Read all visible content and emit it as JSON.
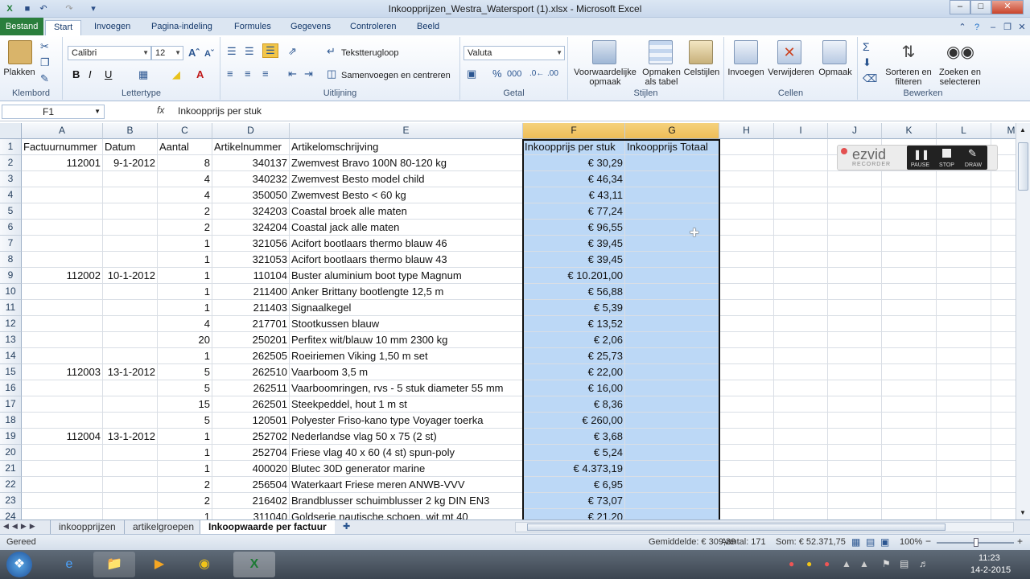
{
  "window": {
    "title": "Inkoopprijzen_Westra_Watersport (1).xlsx - Microsoft Excel"
  },
  "ribbon_tabs": [
    "Bestand",
    "Start",
    "Invoegen",
    "Pagina-indeling",
    "Formules",
    "Gegevens",
    "Controleren",
    "Beeld"
  ],
  "ribbon": {
    "clipboard": {
      "paste": "Plakken",
      "label": "Klembord"
    },
    "font": {
      "name": "Calibri",
      "size": "12",
      "label": "Lettertype"
    },
    "alignment": {
      "wrap": "Tekstterugloop",
      "merge": "Samenvoegen en centreren",
      "label": "Uitlijning"
    },
    "number": {
      "format": "Valuta",
      "label": "Getal"
    },
    "styles": {
      "conditional": "Voorwaardelijke opmaak",
      "table": "Opmaken als tabel",
      "cellstyles": "Celstijlen",
      "label": "Stijlen"
    },
    "cells": {
      "insert": "Invoegen",
      "delete": "Verwijderen",
      "format": "Opmaak",
      "label": "Cellen"
    },
    "editing": {
      "sort": "Sorteren en filteren",
      "find": "Zoeken en selecteren",
      "label": "Bewerken"
    }
  },
  "formula_bar": {
    "name_box": "F1",
    "fx": "fx",
    "content": "Inkoopprijs per stuk"
  },
  "columns": [
    "A",
    "B",
    "C",
    "D",
    "E",
    "F",
    "G",
    "H",
    "I",
    "J",
    "K",
    "L",
    "M"
  ],
  "rows": [
    {
      "n": "1",
      "a": "Factuurnummer",
      "b": "Datum",
      "c": "Aantal",
      "d": "Artikelnummer",
      "e": "Artikelomschrijving",
      "f": "Inkoopprijs per stuk",
      "g": "Inkoopprijs Totaal"
    },
    {
      "n": "2",
      "a": "112001",
      "b": "9-1-2012",
      "c": "8",
      "d": "340137",
      "e": "Zwemvest Bravo 100N 80-120 kg",
      "f": "€ 30,29",
      "g": ""
    },
    {
      "n": "3",
      "a": "",
      "b": "",
      "c": "4",
      "d": "340232",
      "e": "Zwemvest Besto model child",
      "f": "€ 46,34",
      "g": ""
    },
    {
      "n": "4",
      "a": "",
      "b": "",
      "c": "4",
      "d": "350050",
      "e": "Zwemvest Besto < 60 kg",
      "f": "€ 43,11",
      "g": ""
    },
    {
      "n": "5",
      "a": "",
      "b": "",
      "c": "2",
      "d": "324203",
      "e": "Coastal broek alle maten",
      "f": "€ 77,24",
      "g": ""
    },
    {
      "n": "6",
      "a": "",
      "b": "",
      "c": "2",
      "d": "324204",
      "e": "Coastal jack alle maten",
      "f": "€ 96,55",
      "g": ""
    },
    {
      "n": "7",
      "a": "",
      "b": "",
      "c": "1",
      "d": "321056",
      "e": "Acifort bootlaars thermo blauw 46",
      "f": "€ 39,45",
      "g": ""
    },
    {
      "n": "8",
      "a": "",
      "b": "",
      "c": "1",
      "d": "321053",
      "e": "Acifort bootlaars thermo blauw 43",
      "f": "€ 39,45",
      "g": ""
    },
    {
      "n": "9",
      "a": "112002",
      "b": "10-1-2012",
      "c": "1",
      "d": "110104",
      "e": "Buster aluminium boot type Magnum",
      "f": "€ 10.201,00",
      "g": ""
    },
    {
      "n": "10",
      "a": "",
      "b": "",
      "c": "1",
      "d": "211400",
      "e": "Anker Brittany bootlengte 12,5 m",
      "f": "€ 56,88",
      "g": ""
    },
    {
      "n": "11",
      "a": "",
      "b": "",
      "c": "1",
      "d": "211403",
      "e": "Signaalkegel",
      "f": "€ 5,39",
      "g": ""
    },
    {
      "n": "12",
      "a": "",
      "b": "",
      "c": "4",
      "d": "217701",
      "e": "Stootkussen blauw",
      "f": "€ 13,52",
      "g": ""
    },
    {
      "n": "13",
      "a": "",
      "b": "",
      "c": "20",
      "d": "250201",
      "e": "Perfitex wit/blauw 10 mm 2300 kg",
      "f": "€ 2,06",
      "g": ""
    },
    {
      "n": "14",
      "a": "",
      "b": "",
      "c": "1",
      "d": "262505",
      "e": "Roeiriemen Viking 1,50 m set",
      "f": "€ 25,73",
      "g": ""
    },
    {
      "n": "15",
      "a": "112003",
      "b": "13-1-2012",
      "c": "5",
      "d": "262510",
      "e": "Vaarboom 3,5 m",
      "f": "€ 22,00",
      "g": ""
    },
    {
      "n": "16",
      "a": "",
      "b": "",
      "c": "5",
      "d": "262511",
      "e": "Vaarboomringen, rvs - 5 stuk diameter 55 mm",
      "f": "€ 16,00",
      "g": ""
    },
    {
      "n": "17",
      "a": "",
      "b": "",
      "c": "15",
      "d": "262501",
      "e": "Steekpeddel, hout 1 m st",
      "f": "€ 8,36",
      "g": ""
    },
    {
      "n": "18",
      "a": "",
      "b": "",
      "c": "5",
      "d": "120501",
      "e": "Polyester Friso-kano type Voyager toerka",
      "f": "€ 260,00",
      "g": ""
    },
    {
      "n": "19",
      "a": "112004",
      "b": "13-1-2012",
      "c": "1",
      "d": "252702",
      "e": "Nederlandse vlag 50 x 75 (2 st)",
      "f": "€ 3,68",
      "g": ""
    },
    {
      "n": "20",
      "a": "",
      "b": "",
      "c": "1",
      "d": "252704",
      "e": "Friese vlag 40 x 60 (4 st) spun-poly",
      "f": "€ 5,24",
      "g": ""
    },
    {
      "n": "21",
      "a": "",
      "b": "",
      "c": "1",
      "d": "400020",
      "e": "Blutec 30D generator marine",
      "f": "€ 4.373,19",
      "g": ""
    },
    {
      "n": "22",
      "a": "",
      "b": "",
      "c": "2",
      "d": "256504",
      "e": "Waterkaart Friese meren ANWB-VVV",
      "f": "€ 6,95",
      "g": ""
    },
    {
      "n": "23",
      "a": "",
      "b": "",
      "c": "2",
      "d": "216402",
      "e": "Brandblusser schuimblusser 2 kg DIN EN3",
      "f": "€ 73,07",
      "g": ""
    },
    {
      "n": "24",
      "a": "",
      "b": "",
      "c": "1",
      "d": "311040",
      "e": "Goldserie nautische schoen, wit mt 40",
      "f": "€ 21,20",
      "g": ""
    }
  ],
  "sheet_tabs": [
    "inkoopprijzen",
    "artikelgroepen",
    "Inkoopwaarde per factuur"
  ],
  "status": {
    "ready": "Gereed",
    "average": "Gemiddelde: € 309,89",
    "count": "Aantal: 171",
    "sum": "Som: € 52.371,75",
    "zoom": "100%"
  },
  "ezvid": {
    "logo": "ezvid",
    "sub": "RECORDER",
    "pause": "PAUSE",
    "stop": "STOP",
    "draw": "DRAW"
  },
  "clock": {
    "time": "11:23",
    "date": "14-2-2015"
  },
  "colors": {
    "file_tab": "#2a7e3c",
    "selection": "#bcd8f6",
    "header_selected": "#eebd57"
  }
}
